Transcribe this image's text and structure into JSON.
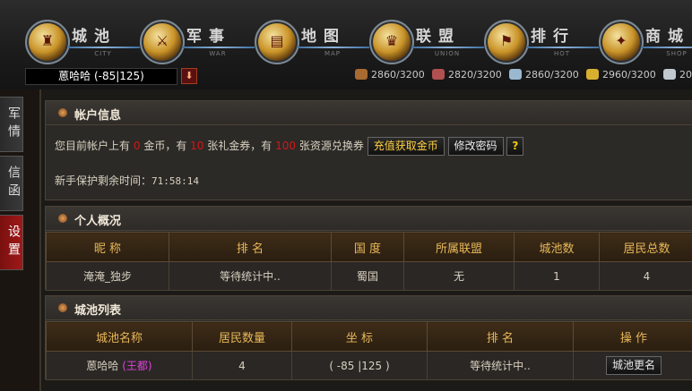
{
  "nav": [
    {
      "zh": "城池",
      "en": "CITY",
      "glyph": "♜",
      "icon": "castle-icon"
    },
    {
      "zh": "军事",
      "en": "WAR",
      "glyph": "⚔",
      "icon": "swords-icon"
    },
    {
      "zh": "地图",
      "en": "MAP",
      "glyph": "▤",
      "icon": "map-scroll-icon"
    },
    {
      "zh": "联盟",
      "en": "UNION",
      "glyph": "♛",
      "icon": "alliance-icon"
    },
    {
      "zh": "排行",
      "en": "HOT",
      "glyph": "⚑",
      "icon": "ranking-banner-icon"
    },
    {
      "zh": "商城",
      "en": "SHOP",
      "glyph": "✦",
      "icon": "treasure-chest-icon"
    }
  ],
  "city_selector": {
    "name": "蒽哈哈 (-85|125)"
  },
  "resources": [
    {
      "value": "2860/3200",
      "icon": "wood-icon",
      "color": "#a86a30"
    },
    {
      "value": "2820/3200",
      "icon": "stone-icon",
      "color": "#b05050"
    },
    {
      "value": "2860/3200",
      "icon": "iron-icon",
      "color": "#9ab8d0"
    },
    {
      "value": "2960/3200",
      "icon": "grain-icon",
      "color": "#d8b030"
    },
    {
      "value": "20",
      "icon": "silver-icon",
      "color": "#c0c8d0"
    }
  ],
  "side_tabs": [
    "军情",
    "信函",
    "设置"
  ],
  "account": {
    "title": "帐户信息",
    "t1": "您目前帐户上有",
    "gold": "0",
    "t2": "金币，有",
    "coupons": "10",
    "t3": "张礼金券，有",
    "vouchers": "100",
    "t4": "张资源兑换券",
    "recharge": "充值获取金币",
    "change_pwd": "修改密码",
    "help": "?",
    "protection_label": "新手保护剩余时间：",
    "protection_time": "71:58:14"
  },
  "personal": {
    "title": "个人概况",
    "headers": [
      "昵 称",
      "排 名",
      "国 度",
      "所属联盟",
      "城池数",
      "居民总数"
    ],
    "row": [
      "淹淹_独步",
      "等待统计中..",
      "蜀国",
      "无",
      "1",
      "4"
    ]
  },
  "cities": {
    "title": "城池列表",
    "headers": [
      "城池名称",
      "居民数量",
      "坐 标",
      "排 名",
      "操 作"
    ],
    "row": {
      "name": "蒽哈哈",
      "tag": "(王都)",
      "population": "4",
      "coords": "( -85 |125 )",
      "rank": "等待统计中..",
      "action": "城池更名"
    }
  }
}
